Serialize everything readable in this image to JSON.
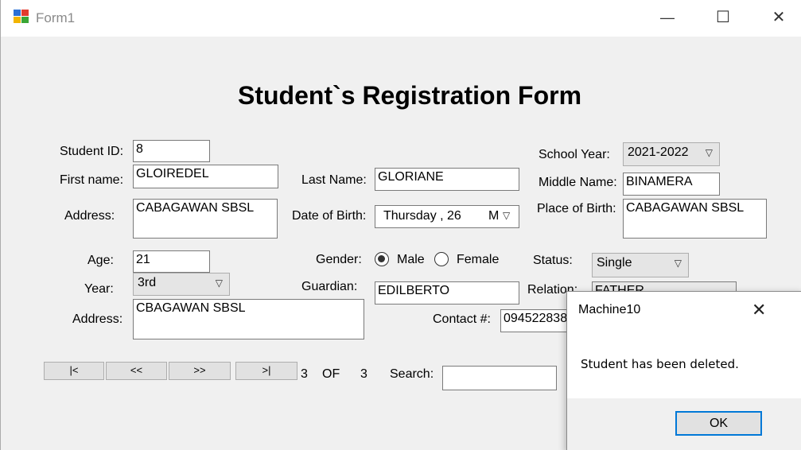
{
  "window": {
    "title": "Form1",
    "minimize": "—",
    "maximize": "☐",
    "close": "✕"
  },
  "form": {
    "heading": "Student`s Registration Form",
    "student_id": {
      "label": "Student ID:",
      "value": "8"
    },
    "first_name": {
      "label": "First name:",
      "value": "GLOIREDEL"
    },
    "address": {
      "label": "Address:",
      "value": "CABAGAWAN SBSL"
    },
    "last_name": {
      "label": "Last Name:",
      "value": "GLORIANE"
    },
    "date_of_birth": {
      "label": "Date of Birth:",
      "value": "Thursday  , 26",
      "suffix": "M"
    },
    "school_year": {
      "label": "School Year:",
      "value": "2021-2022"
    },
    "middle_name": {
      "label": "Middle Name:",
      "value": "BINAMERA"
    },
    "place_of_birth": {
      "label": "Place of Birth:",
      "value": "CABAGAWAN SBSL"
    },
    "age": {
      "label": "Age:",
      "value": "21"
    },
    "year": {
      "label": "Year:",
      "value": "3rd"
    },
    "guardian_address": {
      "label": "Address:",
      "value": "CBAGAWAN SBSL"
    },
    "gender": {
      "label": "Gender:",
      "options": [
        "Male",
        "Female"
      ],
      "selected": "Male"
    },
    "guardian": {
      "label": "Guardian:",
      "value": "EDILBERTO"
    },
    "contact": {
      "label": "Contact #:",
      "value": "094522838"
    },
    "status": {
      "label": "Status:",
      "value": "Single"
    },
    "relation": {
      "label": "Relation:",
      "value": "FATHER"
    }
  },
  "navigation": {
    "first": "|<",
    "prev": "<<",
    "next": ">>",
    "last": ">|",
    "current": "3",
    "of": "OF",
    "total": "3",
    "search_label": "Search:",
    "search_value": ""
  },
  "dialog": {
    "title": "Machine10",
    "close": "✕",
    "message": "Student has been deleted.",
    "ok_label": "OK"
  },
  "colors": {
    "accent": "#0078d7",
    "form_bg": "#f0f0f0"
  }
}
